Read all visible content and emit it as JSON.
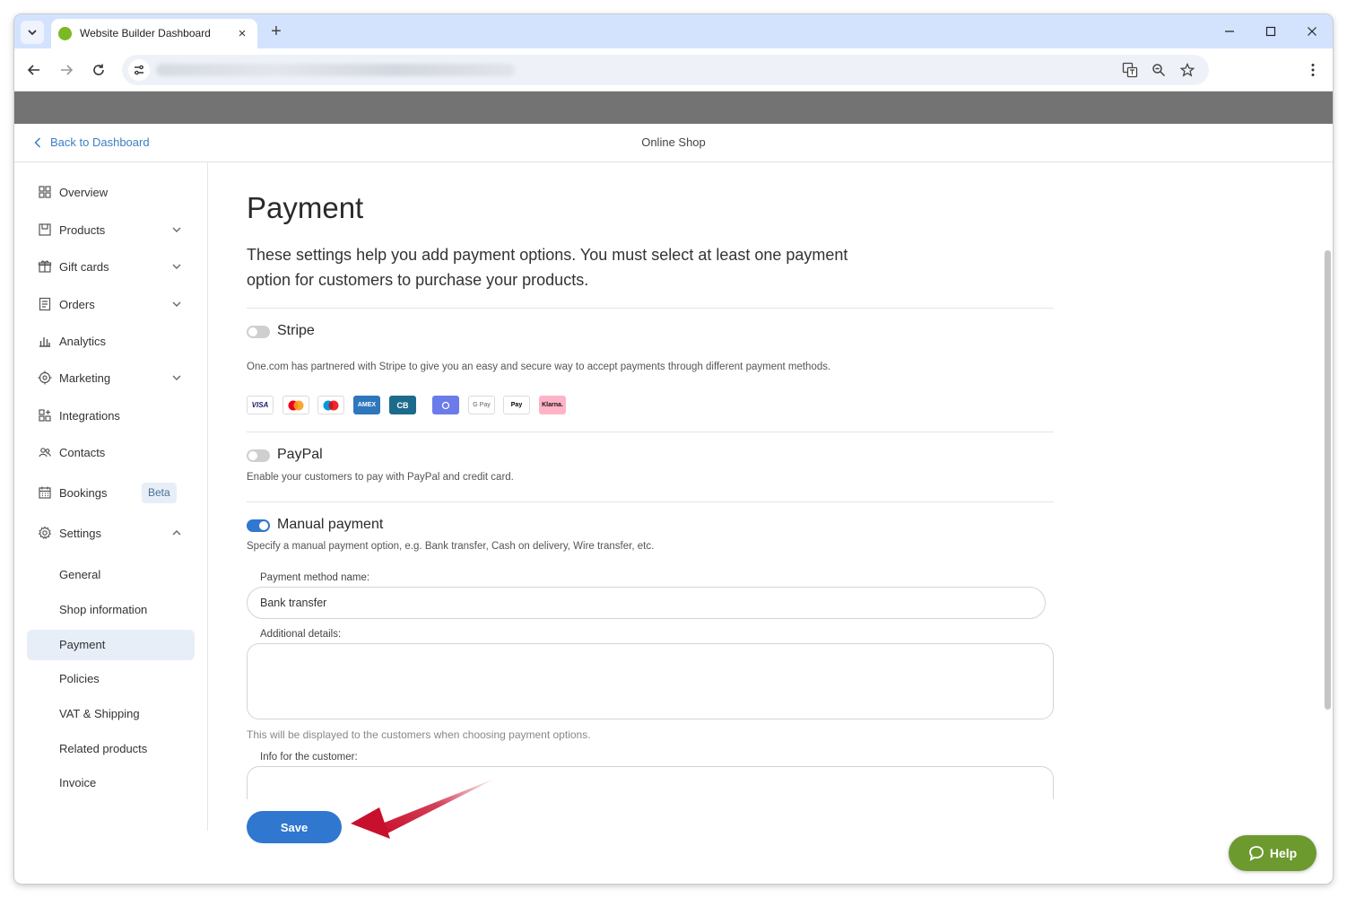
{
  "browser": {
    "tab_title": "Website Builder Dashboard",
    "tab_close": "×",
    "new_tab": "+"
  },
  "header": {
    "back_label": "Back to Dashboard",
    "title": "Online Shop"
  },
  "sidebar": {
    "items": [
      {
        "label": "Overview",
        "icon": "grid-icon",
        "expandable": false
      },
      {
        "label": "Products",
        "icon": "box-icon",
        "expandable": true
      },
      {
        "label": "Gift cards",
        "icon": "gift-icon",
        "expandable": true
      },
      {
        "label": "Orders",
        "icon": "list-icon",
        "expandable": true
      },
      {
        "label": "Analytics",
        "icon": "bar-chart-icon",
        "expandable": false
      },
      {
        "label": "Marketing",
        "icon": "target-icon",
        "expandable": true
      },
      {
        "label": "Integrations",
        "icon": "puzzle-icon",
        "expandable": false
      },
      {
        "label": "Contacts",
        "icon": "people-icon",
        "expandable": false
      },
      {
        "label": "Bookings",
        "icon": "calendar-icon",
        "expandable": false,
        "badge": "Beta"
      },
      {
        "label": "Settings",
        "icon": "gear-icon",
        "expandable": true,
        "expanded": true
      }
    ],
    "settings_children": [
      {
        "label": "General"
      },
      {
        "label": "Shop information"
      },
      {
        "label": "Payment",
        "active": true
      },
      {
        "label": "Policies"
      },
      {
        "label": "VAT & Shipping"
      },
      {
        "label": "Related products"
      },
      {
        "label": "Invoice"
      }
    ]
  },
  "main": {
    "title": "Payment",
    "intro": "These settings help you add payment options. You must select at least one payment option for customers to purchase your products.",
    "stripe": {
      "title": "Stripe",
      "enabled": false,
      "description": "One.com has partnered with Stripe to give you an easy and secure way to accept payments through different payment methods.",
      "methods": [
        {
          "name": "VISA",
          "color": "#1a1f71"
        },
        {
          "name": "mastercard",
          "color": "#eb001b"
        },
        {
          "name": "maestro",
          "color": "#0099df"
        },
        {
          "name": "AMEX",
          "color": "#2e77bc"
        },
        {
          "name": "CB",
          "color": "#1d6b8c"
        },
        {
          "name": "Link",
          "color": "#6c7bea"
        },
        {
          "name": "G Pay",
          "color": "#5f6368"
        },
        {
          "name": "Pay",
          "color": "#000000"
        },
        {
          "name": "Klarna.",
          "color": "#ffb3c7"
        }
      ]
    },
    "paypal": {
      "title": "PayPal",
      "enabled": false,
      "description": "Enable your customers to pay with PayPal and credit card."
    },
    "manual": {
      "title": "Manual payment",
      "enabled": true,
      "description": "Specify a manual payment option, e.g. Bank transfer, Cash on delivery, Wire transfer, etc.",
      "method_name_label": "Payment method name:",
      "method_name_value": "Bank transfer",
      "details_label": "Additional details:",
      "details_value": "",
      "details_hint": "This will be displayed to the customers when choosing payment options.",
      "customer_info_label": "Info for the customer:",
      "customer_info_value": ""
    },
    "save_label": "Save"
  },
  "help": {
    "label": "Help"
  },
  "colors": {
    "accent": "#2f77cf",
    "help_green": "#6d9a2f",
    "annotation_arrow": "#c8102e"
  }
}
